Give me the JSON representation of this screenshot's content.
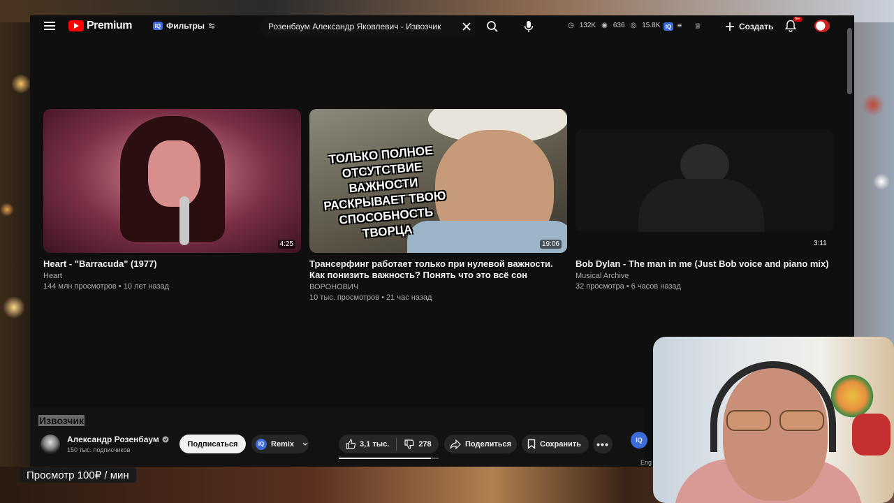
{
  "masthead": {
    "logo_text": "Premium",
    "filters_label": "Фильтры",
    "iq_label": "IQ",
    "search_value": "Розенбаум Александр Яковлевич - Извозчик",
    "stats": {
      "views": "132K",
      "watching": "636",
      "seen": "15.8K"
    },
    "create_label": "Создать",
    "notifications_badge": "9+"
  },
  "videos": [
    {
      "title": "Heart - \"Barracuda\" (1977)",
      "channel": "Heart",
      "meta": "144 млн просмотров • 10 лет назад",
      "duration": "4:25"
    },
    {
      "title": "Трансерфинг работает только при нулевой важности. Как понизить важность? Понять что это всё сон",
      "channel": "ВОРОНОВИЧ",
      "meta": "10 тыс. просмотров • 21 час назад",
      "duration": "19:06",
      "overlay": "ТОЛЬКО ПОЛНОЕ ОТСУТСТВИЕ ВАЖНОСТИ РАСКРЫВАЕТ ТВОЮ СПОСОБНОСТЬ ТВОРЦА"
    },
    {
      "title": "Bob Dylan - The man in me (Just Bob voice and piano mix)",
      "channel": "Musical Archive",
      "meta": "32 просмотра • 6 часов назад",
      "duration": "3:11"
    }
  ],
  "player": {
    "title": "Извозчик",
    "channel_name": "Александр Розенбаум",
    "subscribers": "150 тыс. подписчиков",
    "subscribe_label": "Подписаться",
    "remix_label": "Remix",
    "likes": "3,1 тыс.",
    "dislikes": "278",
    "like_ratio": 0.92,
    "share_label": "Поделиться",
    "save_label": "Сохранить",
    "lang_label": "Eng"
  },
  "overlay": {
    "price_label": "Просмотр 100₽ / мин"
  }
}
